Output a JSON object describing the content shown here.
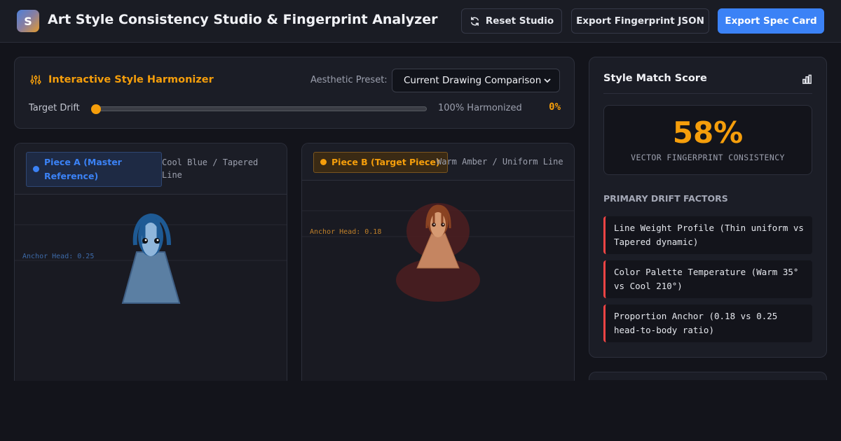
{
  "header": {
    "logo_letter": "S",
    "title": "Art Style Consistency Studio & Fingerprint Analyzer",
    "buttons": {
      "reset": "Reset Studio",
      "export_json": "Export Fingerprint JSON",
      "export_card": "Export Spec Card"
    }
  },
  "harmonizer": {
    "title": "Interactive Style Harmonizer",
    "preset_label": "Aesthetic Preset:",
    "preset_value": "Current Drawing Comparison",
    "drift_label": "Target Drift",
    "harmonized_label": "100% Harmonized",
    "drift_value": "0%",
    "drift_fraction": 0
  },
  "piece_a": {
    "badge": "Piece A (Master Reference)",
    "style": "Cool Blue / Tapered Line",
    "anchor_label": "Anchor Head: 0.25",
    "color": "#3b82f6"
  },
  "piece_b": {
    "badge": "Piece B (Target Piece)",
    "style": "Warm Amber / Uniform Line",
    "anchor_label": "Anchor Head: 0.18",
    "color": "#f59e0b"
  },
  "score": {
    "title": "Style Match Score",
    "value": "58%",
    "subtitle": "VECTOR FINGERPRINT CONSISTENCY",
    "factors_title": "PRIMARY DRIFT FACTORS",
    "factors": [
      "Line Weight Profile (Thin uniform vs Tapered dynamic)",
      "Color Palette Temperature (Warm 35° vs Cool 210°)",
      "Proportion Anchor (0.18 vs 0.25 head-to-body ratio)"
    ]
  }
}
